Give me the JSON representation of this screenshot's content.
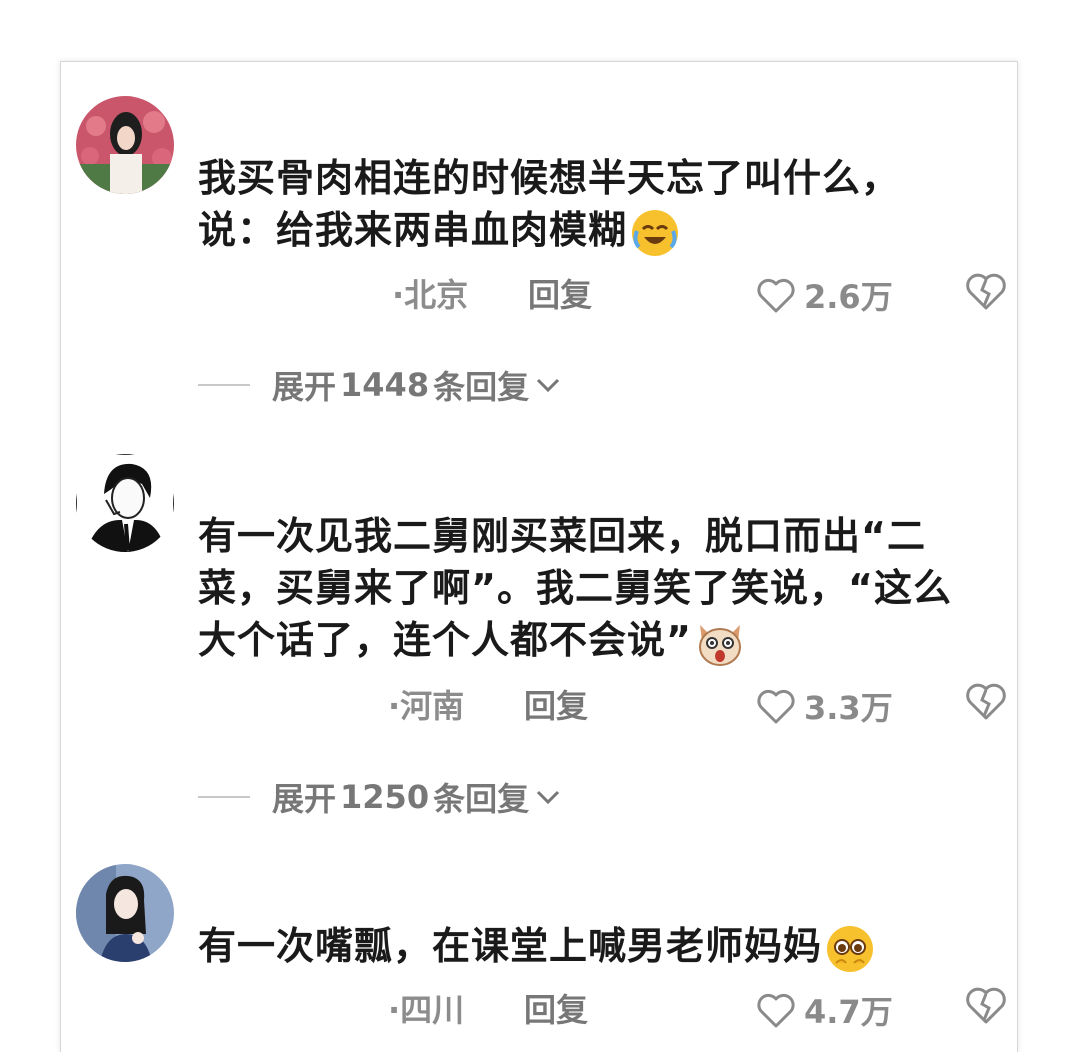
{
  "comments": [
    {
      "text_lines": [
        "我买骨肉相连的时候想半天忘了叫什么，",
        "说：给我来两串血肉模糊"
      ],
      "emoji_icon": "crying-laughing-face-icon",
      "location": "·北京",
      "reply_label": "回复",
      "likes": "2.6万",
      "expand": {
        "prefix": "展开",
        "count": "1448",
        "suffix": "条回复"
      }
    },
    {
      "text_lines": [
        "有一次见我二舅刚买菜回来，脱口而出“二",
        "菜，买舅来了啊”。我二舅笑了笑说，“这么",
        "大个话了，连个人都不会说”"
      ],
      "emoji_icon": "surprised-dog-face-icon",
      "location": "·河南",
      "reply_label": "回复",
      "likes": "3.3万",
      "expand": {
        "prefix": "展开",
        "count": "1250",
        "suffix": "条回复"
      }
    },
    {
      "text_lines": [
        "有一次嘴瓢，在课堂上喊男老师妈妈"
      ],
      "emoji_icon": "pleading-face-icon",
      "location": "·四川",
      "reply_label": "回复",
      "likes": "4.7万"
    }
  ]
}
